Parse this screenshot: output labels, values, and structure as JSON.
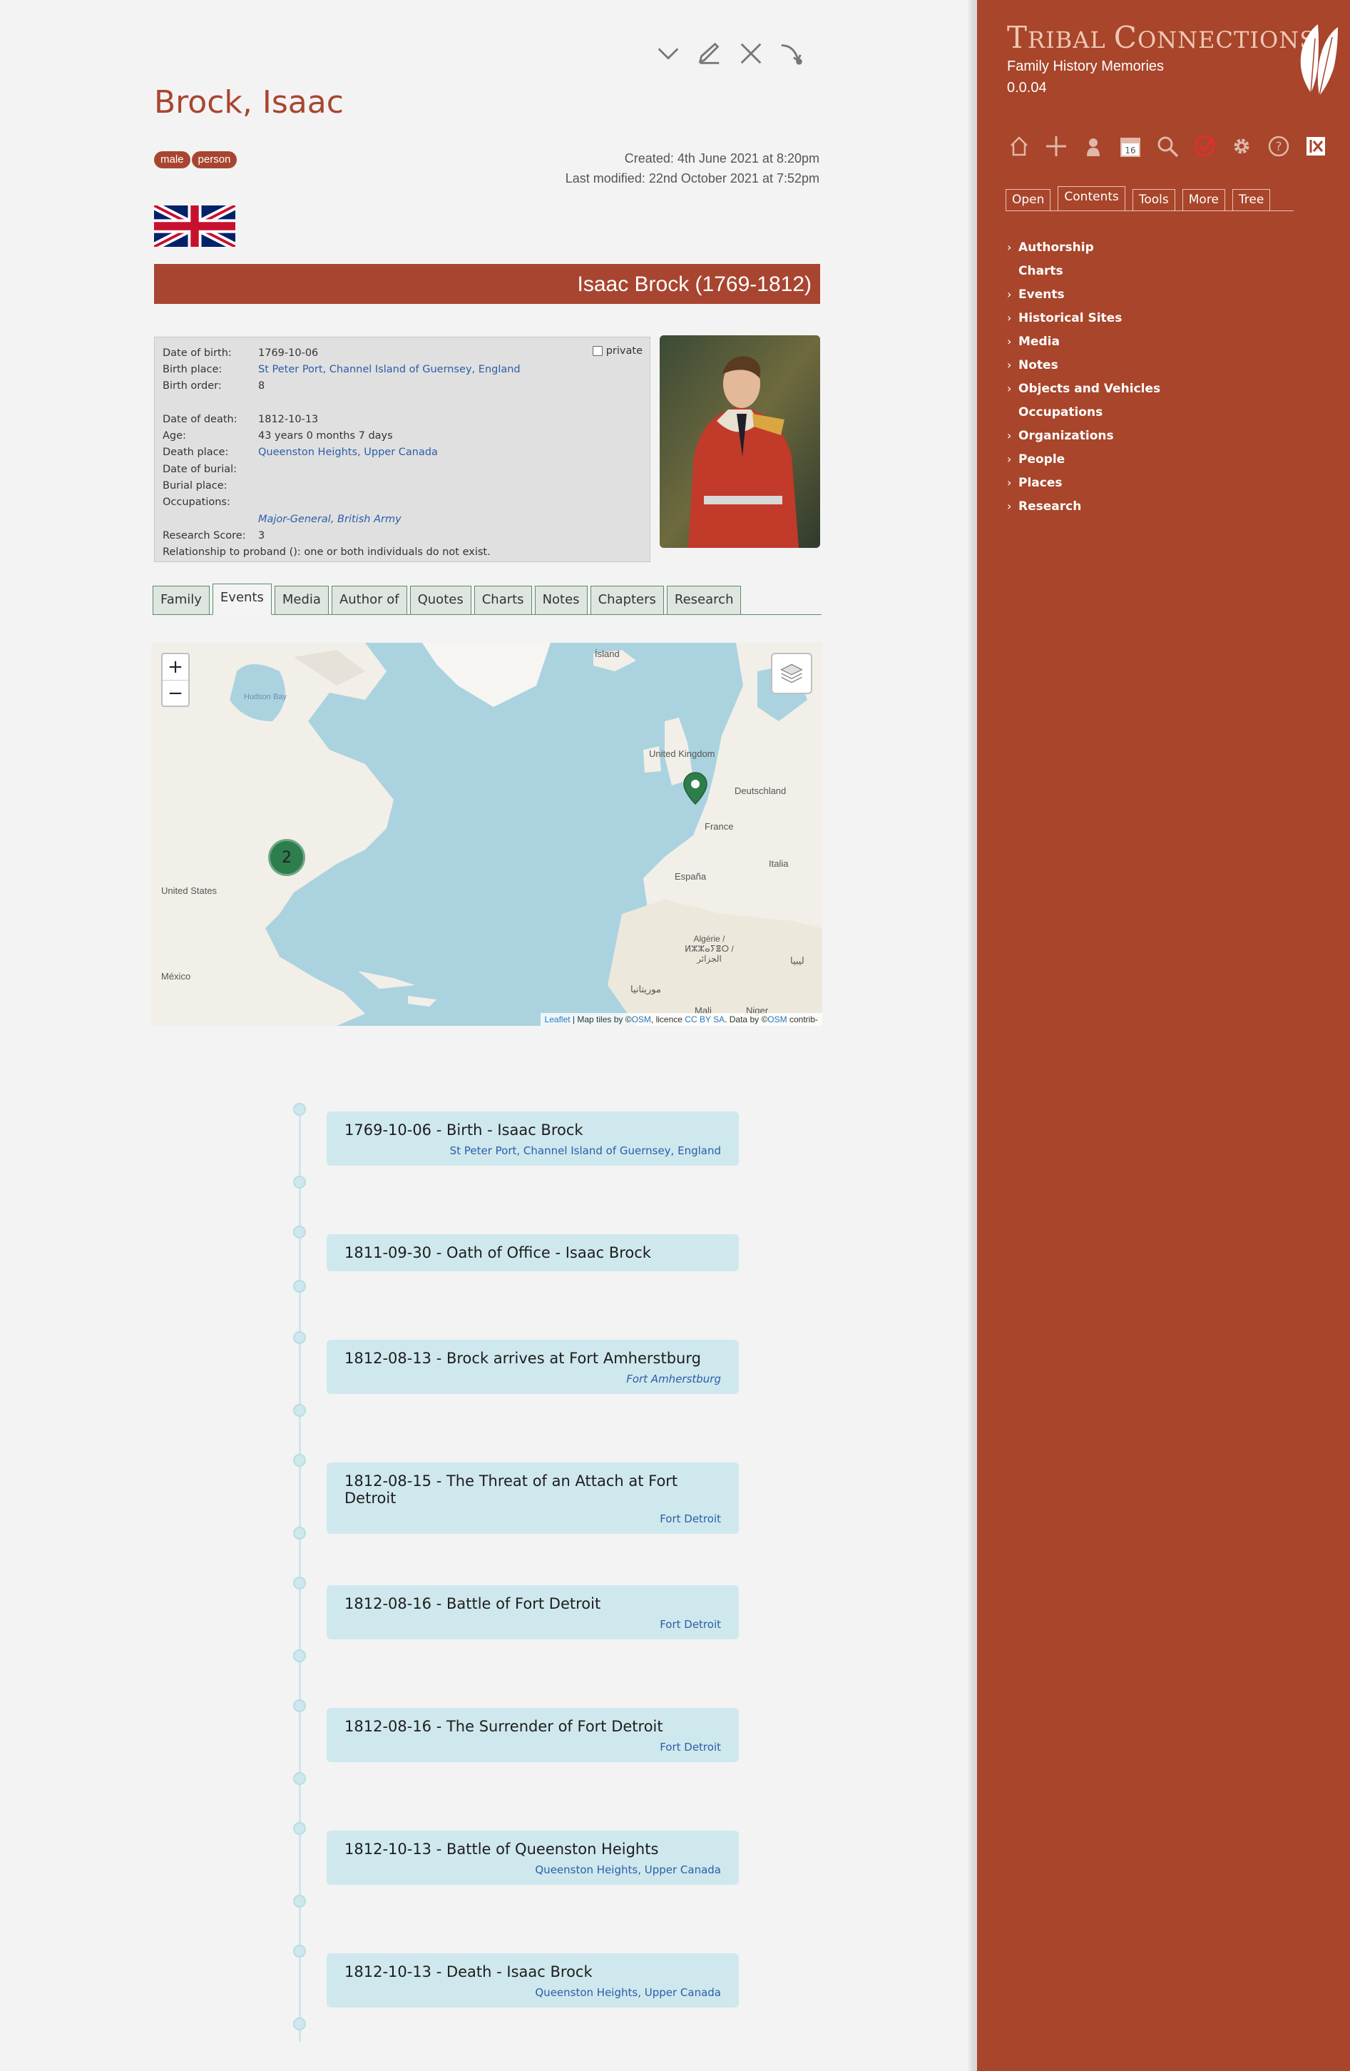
{
  "person": {
    "name": "Brock, Isaac",
    "tags": [
      "male",
      "person"
    ],
    "created": "Created: 4th June 2021 at 8:20pm",
    "modified": "Last modified: 22nd October 2021 at 7:52pm",
    "banner": "Isaac Brock (1769-1812)",
    "private_label": "private",
    "details": {
      "dob_label": "Date of birth:",
      "dob": "1769-10-06",
      "birthplace_label": "Birth place:",
      "birthplace": "St Peter Port, Channel Island of Guernsey, England",
      "birthorder_label": "Birth order:",
      "birthorder": "8",
      "dod_label": "Date of death:",
      "dod": "1812-10-13",
      "age_label": "Age:",
      "age": "43 years 0 months 7 days",
      "deathplace_label": "Death place:",
      "deathplace": "Queenston Heights, Upper Canada",
      "burialdate_label": "Date of burial:",
      "burialplace_label": "Burial place:",
      "occupations_label": "Occupations:",
      "occupation": "Major-General, British Army",
      "score_label": "Research Score:",
      "score": "3",
      "relationship": "Relationship to proband (): one or both individuals do not exist."
    }
  },
  "tabs": [
    "Family",
    "Events",
    "Media",
    "Author of",
    "Quotes",
    "Charts",
    "Notes",
    "Chapters",
    "Research"
  ],
  "active_tab": "Events",
  "map": {
    "zoom_in": "+",
    "zoom_out": "−",
    "cluster_count": "2",
    "labels": {
      "island": "Ísland",
      "hudson": "Hudson Bay",
      "uk": "United Kingdom",
      "deutschland": "Deutschland",
      "france": "France",
      "espana": "España",
      "italia": "Italia",
      "us": "United States",
      "algerie": "Algérie / ⵍⵣⵣⴰⵢⴻⵔ / الجزائر",
      "mexico": "México",
      "mali": "Mali",
      "niger": "Niger",
      "mauritanie": "موريتانيا",
      "libya": "ليبيا"
    },
    "attribution": {
      "leaflet": "Leaflet",
      "sep1": " | Map tiles by ©",
      "osm1": "OSM",
      "licence": ", licence ",
      "ccbysa": "CC BY SA",
      "data": ". Data by ©",
      "osm2": "OSM",
      "contrib": " contrib-"
    }
  },
  "timeline": [
    {
      "title": "1769-10-06 - Birth - Isaac Brock",
      "place": "St Peter Port, Channel Island of Guernsey, England",
      "italic": false
    },
    {
      "title": "1811-09-30 - Oath of Office - Isaac Brock",
      "place": "",
      "italic": false
    },
    {
      "title": "1812-08-13 - Brock arrives at Fort Amherstburg",
      "place": "Fort Amherstburg",
      "italic": true
    },
    {
      "title": "1812-08-15 - The Threat of an Attach at Fort Detroit",
      "place": "Fort Detroit",
      "italic": false
    },
    {
      "title": "1812-08-16 - Battle of Fort Detroit",
      "place": "Fort Detroit",
      "italic": false
    },
    {
      "title": "1812-08-16 - The Surrender of Fort Detroit",
      "place": "Fort Detroit",
      "italic": false
    },
    {
      "title": "1812-10-13 - Battle of Queenston Heights",
      "place": "Queenston Heights, Upper Canada",
      "italic": false
    },
    {
      "title": "1812-10-13 - Death - Isaac Brock",
      "place": "Queenston Heights, Upper Canada",
      "italic": false
    }
  ],
  "sidebar": {
    "title_first": "T",
    "title_first_rest": "RIBAL ",
    "title_second": "C",
    "title_second_rest": "ONNECTIONS",
    "subtitle": "Family History Memories",
    "version": "0.0.04",
    "calendar_day": "16",
    "tabs": [
      "Open",
      "Contents",
      "Tools",
      "More",
      "Tree"
    ],
    "active_tab": "Contents",
    "tree": [
      {
        "label": "Authorship",
        "expandable": true
      },
      {
        "label": "Charts",
        "expandable": false
      },
      {
        "label": "Events",
        "expandable": true
      },
      {
        "label": "Historical Sites",
        "expandable": true
      },
      {
        "label": "Media",
        "expandable": true
      },
      {
        "label": "Notes",
        "expandable": true
      },
      {
        "label": "Objects and Vehicles",
        "expandable": true
      },
      {
        "label": "Occupations",
        "expandable": false
      },
      {
        "label": "Organizations",
        "expandable": true
      },
      {
        "label": "People",
        "expandable": true
      },
      {
        "label": "Places",
        "expandable": true
      },
      {
        "label": "Research",
        "expandable": true
      }
    ]
  },
  "colors": {
    "brand": "#a8452b",
    "link": "#2a5ea8",
    "timeline_card": "#cfe8ee",
    "map_water": "#a9d3df",
    "cluster": "#2e7d4c"
  }
}
